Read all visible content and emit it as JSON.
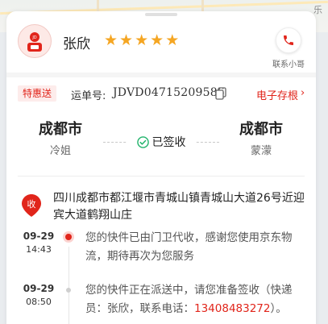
{
  "map": {
    "corner_label": "乐"
  },
  "courier": {
    "name": "张欣",
    "rating_stars": 5,
    "contact_label": "联系小哥",
    "avatar_badge": "JD"
  },
  "waybill": {
    "tag": "特惠送",
    "label": "运单号:",
    "number": "JDVD04715209586",
    "stub_link": "电子存根",
    "stub_arrow": "›"
  },
  "route": {
    "origin_city": "成都市",
    "origin_person": "冷姐",
    "status": "已签收",
    "dest_city": "成都市",
    "dest_person": "蒙濛"
  },
  "address": {
    "pin_label": "收",
    "text": "四川成都市都江堰市青城山镇青城山大道26号近迎宾大道鹤翔山庄"
  },
  "timeline": [
    {
      "date": "09-29",
      "time": "14:43",
      "text": "您的快件已由门卫代收，感谢您使用京东物流，期待再次为您服务",
      "active": true
    },
    {
      "date": "09-29",
      "time": "08:50",
      "text_before": "您的快件正在派送中，请您准备签收（快递员：张欣，联系电话：",
      "phone": "13408483272",
      "text_after": "）。",
      "active": false
    }
  ],
  "colors": {
    "brand_red": "#e1251b",
    "star": "#f5a623",
    "status_green": "#21b36b"
  }
}
